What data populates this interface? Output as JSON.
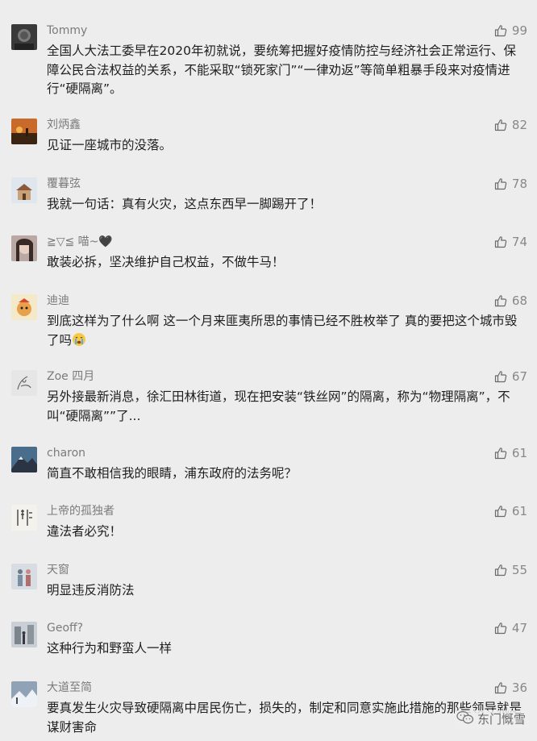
{
  "comments": [
    {
      "name": "Tommy",
      "likes": "99",
      "text": "全国人大法工委早在2020年初就说，要统筹把握好疫情防控与经济社会正常运行、保障公民合法权益的关系，不能采取“锁死家门”“一律劝返”等简单粗暴手段来对疫情进行“硬隔离”。",
      "avatar": "face-dark-icon"
    },
    {
      "name": "刘炳鑫",
      "likes": "82",
      "text": "见证一座城市的没落。",
      "avatar": "sunset-icon"
    },
    {
      "name": "覆暮弦",
      "likes": "78",
      "text": "我就一句话：真有火灾，这点东西早一脚踢开了！",
      "avatar": "house-icon"
    },
    {
      "name": "≧▽≦ 喵~🖤",
      "likes": "74",
      "text": "敢装必拆，坚决维护自己权益，不做牛马！",
      "avatar": "girl-icon"
    },
    {
      "name": "迪迪",
      "likes": "68",
      "text": "到底这样为了什么啊 这一个月来匪夷所思的事情已经不胜枚举了 真的要把这个城市毁了吗",
      "avatar": "cartoon-icon",
      "emoji": "crying-face-icon"
    },
    {
      "name": "Zoe 四月",
      "likes": "67",
      "text": "另外接最新消息，徐汇田林街道，现在把安装“铁丝网”的隔离，称为“物理隔离”，不叫“硬隔离””了...",
      "avatar": "sketch-icon"
    },
    {
      "name": "charon",
      "likes": "61",
      "text": "简直不敢相信我的眼睛，浦东政府的法务呢？",
      "avatar": "mountain-icon"
    },
    {
      "name": "上帝的孤独者",
      "likes": "61",
      "text": "違法者必究！",
      "avatar": "calligraphy-icon"
    },
    {
      "name": "天窗",
      "likes": "55",
      "text": "明显违反消防法",
      "avatar": "people-icon"
    },
    {
      "name": "Geoff?",
      "likes": "47",
      "text": "这种行为和野蛮人一样",
      "avatar": "street-icon"
    },
    {
      "name": "大道至简",
      "likes": "36",
      "text": "要真发生火灾导致硬隔离中居民伤亡，损失的，制定和同意实施此措施的那些领导就是谋财害命",
      "avatar": "snow-icon"
    }
  ],
  "watermark": {
    "text": "东门慨雪",
    "icon": "wechat-icon"
  },
  "colors": {
    "background": "#ededed",
    "name": "#7b7b7b",
    "text": "#1e1e1e",
    "likes": "#888888"
  }
}
